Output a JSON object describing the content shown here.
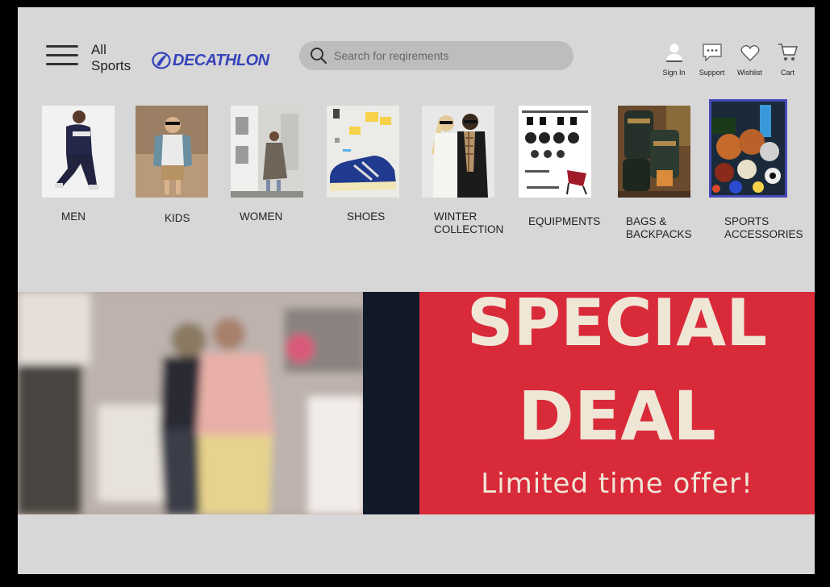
{
  "header": {
    "all_sports": "All Sports",
    "logo": "DECATHLON",
    "search_placeholder": "Search for reqirements",
    "actions": [
      {
        "label": "Sign In",
        "icon": "user-icon"
      },
      {
        "label": "Support",
        "icon": "chat-icon"
      },
      {
        "label": "Wishlist",
        "icon": "heart-icon"
      },
      {
        "label": "Cart",
        "icon": "cart-icon"
      }
    ]
  },
  "categories": [
    {
      "label": "MEN"
    },
    {
      "label": "KIDS"
    },
    {
      "label": "WOMEN"
    },
    {
      "label": "SHOES"
    },
    {
      "label": "WINTER COLLECTION"
    },
    {
      "label": "EQUIPMENTS"
    },
    {
      "label": "BAGS & BACKPACKS"
    },
    {
      "label": "SPORTS ACCESSORIES",
      "selected": true
    }
  ],
  "banner": {
    "line1": "SPECIAL",
    "line2": "DEAL",
    "line3": "Limited time offer!"
  },
  "colors": {
    "brand": "#3643ba",
    "page_bg": "#d7d7d7",
    "banner_red": "#d92a3a",
    "selected_outline": "#4649b8"
  }
}
